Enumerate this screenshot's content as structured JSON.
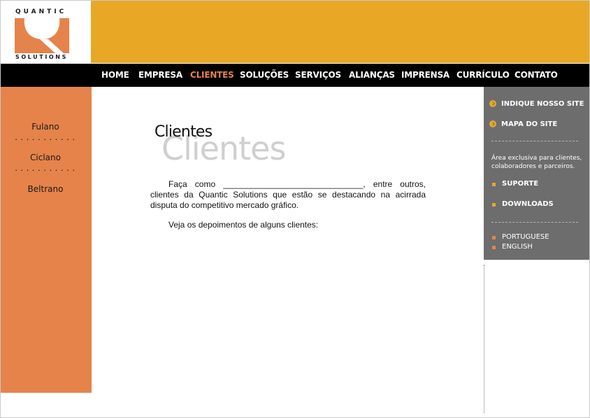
{
  "brand": {
    "logo_top": "QUANTIC",
    "logo_bottom": "SOLUTIONS",
    "header_color": "#e8a826",
    "accent_orange": "#e5834b"
  },
  "nav": {
    "items": [
      {
        "label": "HOME"
      },
      {
        "label": "EMPRESA"
      },
      {
        "label": "CLIENTES",
        "active": true
      },
      {
        "label": "SOLUÇÕES"
      },
      {
        "label": "SERVIÇOS"
      },
      {
        "label": "ALIANÇAS"
      },
      {
        "label": "IMPRENSA"
      },
      {
        "label": "CURRÍCULO"
      },
      {
        "label": "CONTATO"
      }
    ]
  },
  "sidebar": {
    "items": [
      {
        "label": "Fulano"
      },
      {
        "label": "Ciclano"
      },
      {
        "label": "Beltrano"
      }
    ],
    "separator": "..........."
  },
  "main": {
    "title_large": "Clientes",
    "title_small": "Clientes",
    "paragraph1": "Faça como ______________________________, entre outros, clientes da Quantic Solutions que estão se destacando na acirrada disputa do competitivo mercado gráfico.",
    "paragraph2": "Veja os depoimentos de alguns clientes:"
  },
  "right_panel": {
    "links_top": [
      {
        "label": "INDIQUE NOSSO SITE",
        "icon": "arrow-circle-icon"
      },
      {
        "label": "MAPA DO SITE",
        "icon": "arrow-circle-icon"
      }
    ],
    "exclusive_text": "Área exclusiva para clientes, colaboradores e parceiros.",
    "links_mid": [
      {
        "label": "SUPORTE"
      },
      {
        "label": "DOWNLOADS"
      }
    ],
    "languages": [
      {
        "label": "PORTUGUESE"
      },
      {
        "label": "ENGLISH"
      }
    ]
  }
}
